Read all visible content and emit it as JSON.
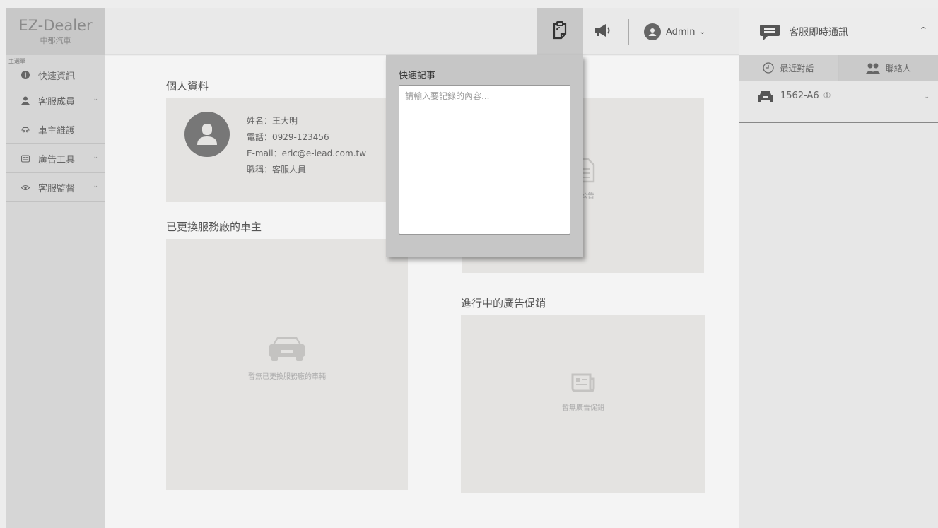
{
  "app": {
    "title": "EZ-Dealer",
    "subtitle": "中都汽車"
  },
  "sidebar": {
    "heading": "主選單",
    "items": [
      {
        "label": "快速資訊",
        "icon": "info-icon",
        "chevron": false
      },
      {
        "label": "客服成員",
        "icon": "person-icon",
        "chevron": true
      },
      {
        "label": "車主維護",
        "icon": "car-icon",
        "chevron": false
      },
      {
        "label": "廣告工具",
        "icon": "ad-icon",
        "chevron": true
      },
      {
        "label": "客服監督",
        "icon": "eye-icon",
        "chevron": true
      }
    ]
  },
  "topbar": {
    "user_name": "Admin",
    "user_caret": "⌄"
  },
  "quick_note": {
    "title": "快速記事",
    "placeholder": "請輸入要記錄的內容..."
  },
  "profile": {
    "title": "個人資料",
    "name": "姓名：王大明",
    "phone": "電話：0929-123456",
    "email": "E-mail：eric@e-lead.com.tw",
    "job": "職稱：客服人員"
  },
  "announcements": {
    "empty_text": "公告"
  },
  "changed_owners": {
    "title": "已更換服務廠的車主",
    "empty_text": "暫無已更換服務廠的車輛"
  },
  "promotions": {
    "title": "進行中的廣告促銷",
    "empty_text": "暫無廣告促銷"
  },
  "chat": {
    "title": "客服即時通訊",
    "tabs": [
      "最近對話",
      "聯絡人"
    ],
    "conversations": [
      {
        "plate": "1562-A6",
        "badge": "①"
      }
    ]
  },
  "colors": {
    "accent": "#666666",
    "panel": "#e4e3e1",
    "sidebar": "#d6d6d6"
  }
}
